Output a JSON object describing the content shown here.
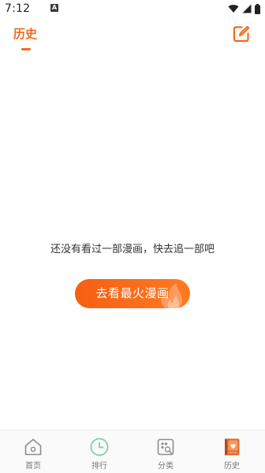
{
  "status_bar": {
    "time": "7:12",
    "notification_badge": "A"
  },
  "header": {
    "active_tab": "历史"
  },
  "empty_state": {
    "message": "还没有看过一部漫画，快去追一部吧",
    "cta_label": "去看最火漫画"
  },
  "bottom_nav": {
    "items": [
      {
        "label": "首页",
        "icon": "home-icon"
      },
      {
        "label": "排行",
        "icon": "clock-icon"
      },
      {
        "label": "分类",
        "icon": "category-icon"
      },
      {
        "label": "历史",
        "icon": "history-book-icon",
        "active": true
      }
    ]
  },
  "colors": {
    "accent": "#f26a1b",
    "cta_start": "#f65f12",
    "cta_end": "#ff7a22",
    "rank_icon": "#7fd1a7",
    "nav_inactive": "#777777"
  }
}
